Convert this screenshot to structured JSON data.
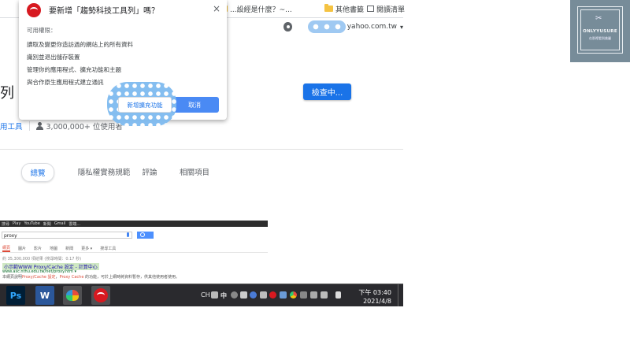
{
  "bookmarks": {
    "items": [
      {
        "label": "...設經是什麼？~..."
      },
      {
        "label": "其他書籤"
      },
      {
        "label": "閱讀清單"
      }
    ]
  },
  "account": {
    "email_suffix": "yahoo.com.tw"
  },
  "store": {
    "title_fragment": "列",
    "check_button": "檢查中...",
    "category": "用工具",
    "users": "3,000,000+ 位使用者",
    "tabs": [
      "總覽",
      "隱私權實務規範",
      "評論",
      "相關項目"
    ]
  },
  "dialog": {
    "title": "要新增「趨勢科技工具列」嗎？",
    "close": "×",
    "perm_heading": "可用權限：",
    "permissions": [
      "讀取及變更你造訪過的網站上的所有資料",
      "識別並退出儲存裝置",
      "管理你的應用程式、擴充功能和主題",
      "與合作原生應用程式建立通訊"
    ],
    "add_button": "新增擴充功能",
    "cancel_button": "取消"
  },
  "embedded": {
    "topbar": [
      "搜尋",
      "Play",
      "YouTube",
      "新聞",
      "Gmail",
      "雲端..."
    ],
    "query": "proxy",
    "nav": [
      "網頁",
      "圖片",
      "影片",
      "地圖",
      "新聞",
      "更多 ▾",
      "搜尋工具"
    ],
    "count": "約 35,300,000 項結果 (搜尋時間：0.17 秒)",
    "result_title": "小示範WWW Proxy/Cache 設定 - 計算中心",
    "result_url": "www.asc.nthu.edu.tw/net/proxy.htm ▾",
    "snippet_pre": "本網頁說明",
    "snippet_hit1": "Proxy/Cache 設定",
    "snippet_mid": "，",
    "snippet_hit2": "Proxy Cache",
    "snippet_post": " 的功能，可於上網時將資料暫存，供其他使用者使用。"
  },
  "taskbar": {
    "ps_label": "Ps",
    "word_label": "W",
    "lang": "CH",
    "ime": "中",
    "time": "下午 03:40",
    "date": "2021/4/8"
  },
  "logo": {
    "name": "ONLYYUSURE",
    "sub": "在那裡看到美麗",
    "symbol": "✂"
  },
  "colors": {
    "accent": "#1a73e8",
    "trend_red": "#d71920",
    "taskbar": "#2a2a2e"
  }
}
